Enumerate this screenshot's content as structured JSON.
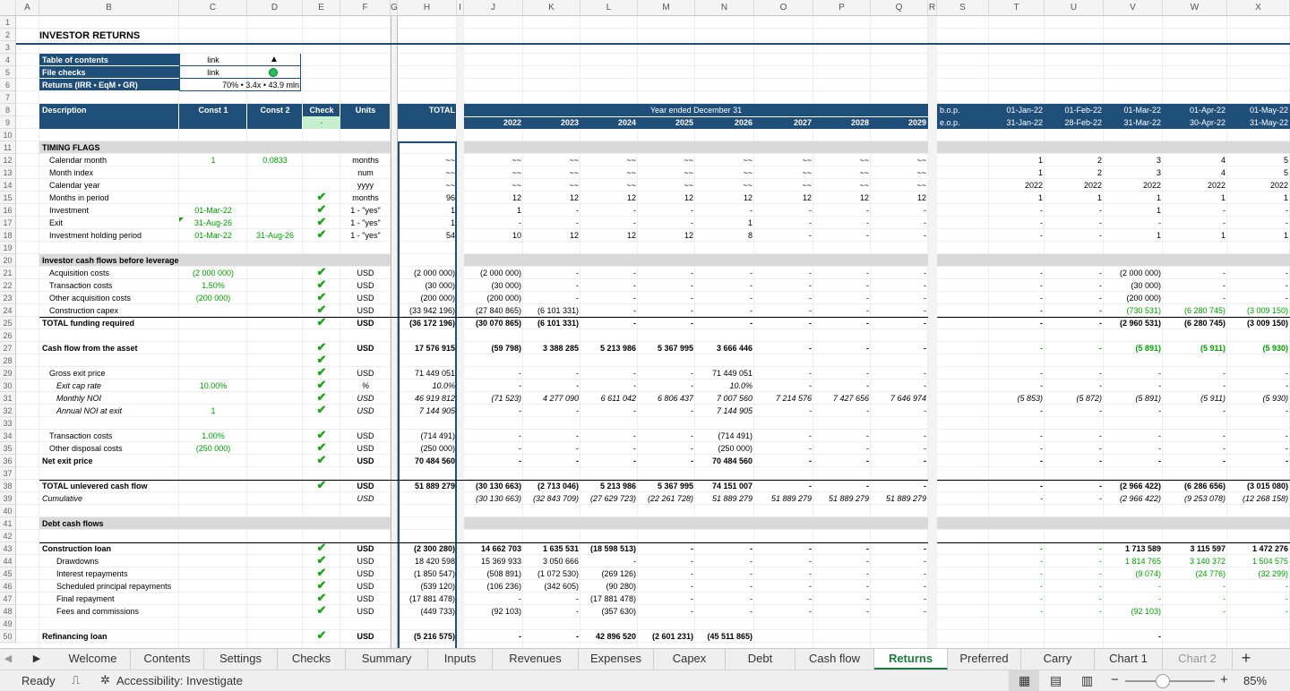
{
  "app": {
    "sheet_name": "Returns",
    "zoom": "85%"
  },
  "columns": [
    "A",
    "B",
    "C",
    "D",
    "E",
    "F",
    "G",
    "H",
    "I",
    "J",
    "K",
    "L",
    "M",
    "N",
    "O",
    "P",
    "Q",
    "R",
    "S",
    "T",
    "U",
    "V",
    "W",
    "X"
  ],
  "rows": [
    "1",
    "2",
    "3",
    "4",
    "5",
    "6",
    "7",
    "8",
    "9",
    "10",
    "11",
    "12",
    "13",
    "14",
    "15",
    "16",
    "17",
    "18",
    "19",
    "20",
    "21",
    "22",
    "23",
    "24",
    "25",
    "26",
    "27",
    "28",
    "29",
    "30",
    "31",
    "32",
    "33",
    "34",
    "35",
    "36",
    "37",
    "38",
    "39",
    "40",
    "41",
    "42",
    "43",
    "44",
    "45",
    "46",
    "47",
    "48",
    "49",
    "50"
  ],
  "title": "INVESTOR RETURNS",
  "toc": {
    "toc_label": "Table of contents",
    "toc_link": "link",
    "toc_icon": "▲",
    "checks_label": "File checks",
    "checks_link": "link",
    "returns_label": "Returns (IRR • EqM • GR)",
    "returns_value": "70% • 3.4x • 43.9 mln"
  },
  "header": {
    "description": "Description",
    "const1": "Const 1",
    "const2": "Const 2",
    "check": "Check",
    "units": "Units",
    "total": "TOTAL",
    "year_ended": "Year ended December 31",
    "check_value": "-",
    "years": [
      "2022",
      "2023",
      "2024",
      "2025",
      "2026",
      "2027",
      "2028",
      "2029"
    ],
    "bop": "b.o.p.",
    "eop": "e.o.p.",
    "month_start": [
      "01-Jan-22",
      "01-Feb-22",
      "01-Mar-22",
      "01-Apr-22",
      "01-May-22"
    ],
    "month_end": [
      "31-Jan-22",
      "28-Feb-22",
      "31-Mar-22",
      "30-Apr-22",
      "31-May-22"
    ]
  },
  "sections": {
    "timing": "TIMING FLAGS",
    "investor": "Investor cash flows before leverage",
    "debt": "Debt cash flows"
  },
  "lines": {
    "r12": {
      "label": "Calendar month",
      "c1": "1",
      "c2": "0.0833",
      "units": "months",
      "total": "~~",
      "y": [
        "~~",
        "~~",
        "~~",
        "~~",
        "~~",
        "~~",
        "~~",
        "~~"
      ],
      "m": [
        "1",
        "2",
        "3",
        "4",
        "5"
      ]
    },
    "r13": {
      "label": "Month index",
      "units": "num",
      "total": "~~",
      "y": [
        "~~",
        "~~",
        "~~",
        "~~",
        "~~",
        "~~",
        "~~",
        "~~"
      ],
      "m": [
        "1",
        "2",
        "3",
        "4",
        "5"
      ]
    },
    "r14": {
      "label": "Calendar year",
      "units": "yyyy",
      "total": "~~",
      "y": [
        "~~",
        "~~",
        "~~",
        "~~",
        "~~",
        "~~",
        "~~",
        "~~"
      ],
      "m": [
        "2022",
        "2022",
        "2022",
        "2022",
        "2022"
      ]
    },
    "r15": {
      "label": "Months in period",
      "units": "months",
      "total": "96",
      "y": [
        "12",
        "12",
        "12",
        "12",
        "12",
        "12",
        "12",
        "12"
      ],
      "m": [
        "1",
        "1",
        "1",
        "1",
        "1"
      ]
    },
    "r16": {
      "label": "Investment",
      "c1": "01-Mar-22",
      "units": "1 - \"yes\"",
      "total": "1",
      "y": [
        "1",
        "-",
        "-",
        "-",
        "-",
        "-",
        "-",
        "-"
      ],
      "m": [
        "-",
        "-",
        "1",
        "-",
        "-"
      ]
    },
    "r17": {
      "label": "Exit",
      "c1": "31-Aug-26",
      "units": "1 - \"yes\"",
      "total": "1",
      "y": [
        "-",
        "-",
        "-",
        "-",
        "1",
        "-",
        "-",
        "-"
      ],
      "m": [
        "-",
        "-",
        "-",
        "-",
        "-"
      ]
    },
    "r18": {
      "label": "Investment holding period",
      "c1": "01-Mar-22",
      "c2": "31-Aug-26",
      "units": "1 - \"yes\"",
      "total": "54",
      "y": [
        "10",
        "12",
        "12",
        "12",
        "8",
        "-",
        "-",
        "-"
      ],
      "m": [
        "-",
        "-",
        "1",
        "1",
        "1"
      ]
    },
    "r21": {
      "label": "Acquisition costs",
      "c1": "(2 000 000)",
      "units": "USD",
      "total": "(2 000 000)",
      "y": [
        "(2 000 000)",
        "-",
        "-",
        "-",
        "-",
        "-",
        "-",
        "-"
      ],
      "m": [
        "-",
        "-",
        "(2 000 000)",
        "-",
        "-"
      ]
    },
    "r22": {
      "label": "Transaction costs",
      "c1": "1.50%",
      "units": "USD",
      "total": "(30 000)",
      "y": [
        "(30 000)",
        "-",
        "-",
        "-",
        "-",
        "-",
        "-",
        "-"
      ],
      "m": [
        "-",
        "-",
        "(30 000)",
        "-",
        "-"
      ]
    },
    "r23": {
      "label": "Other acquisition costs",
      "c1": "(200 000)",
      "units": "USD",
      "total": "(200 000)",
      "y": [
        "(200 000)",
        "-",
        "-",
        "-",
        "-",
        "-",
        "-",
        "-"
      ],
      "m": [
        "-",
        "-",
        "(200 000)",
        "-",
        "-"
      ]
    },
    "r24": {
      "label": "Construction capex",
      "units": "USD",
      "total": "(33 942 196)",
      "y": [
        "(27 840 865)",
        "(6 101 331)",
        "-",
        "-",
        "-",
        "-",
        "-",
        "-"
      ],
      "m": [
        "-",
        "-",
        "(730 531)",
        "(6 280 745)",
        "(3 009 150)"
      ]
    },
    "r25": {
      "label": "TOTAL funding required",
      "units": "USD",
      "total": "(36 172 196)",
      "y": [
        "(30 070 865)",
        "(6 101 331)",
        "-",
        "-",
        "-",
        "-",
        "-",
        "-"
      ],
      "m": [
        "-",
        "-",
        "(2 960 531)",
        "(6 280 745)",
        "(3 009 150)"
      ]
    },
    "r27": {
      "label": "Cash flow from the asset",
      "units": "USD",
      "total": "17 576 915",
      "y": [
        "(59 798)",
        "3 388 285",
        "5 213 986",
        "5 367 995",
        "3 666 446",
        "-",
        "-",
        "-"
      ],
      "m": [
        "-",
        "-",
        "(5 891)",
        "(5 911)",
        "(5 930)"
      ]
    },
    "r29": {
      "label": "Gross exit price",
      "units": "USD",
      "total": "71 449 051",
      "y": [
        "-",
        "-",
        "-",
        "-",
        "71 449 051",
        "-",
        "-",
        "-"
      ],
      "m": [
        "-",
        "-",
        "-",
        "-",
        "-"
      ]
    },
    "r30": {
      "label": "Exit cap rate",
      "c1": "10.00%",
      "units": "%",
      "total": "10.0%",
      "y": [
        "-",
        "-",
        "-",
        "-",
        "10.0%",
        "-",
        "-",
        "-"
      ],
      "m": [
        "-",
        "-",
        "-",
        "-",
        "-"
      ]
    },
    "r31": {
      "label": "Monthly NOI",
      "units": "USD",
      "total": "46 919 812",
      "y": [
        "(71 523)",
        "4 277 090",
        "6 611 042",
        "6 806 437",
        "7 007 560",
        "7 214 576",
        "7 427 656",
        "7 646 974"
      ],
      "m": [
        "(5 853)",
        "(5 872)",
        "(5 891)",
        "(5 911)",
        "(5 930)"
      ]
    },
    "r32": {
      "label": "Annual NOI at exit",
      "c1": "1",
      "units": "USD",
      "total": "7 144 905",
      "y": [
        "-",
        "-",
        "-",
        "-",
        "7 144 905",
        "-",
        "-",
        "-"
      ],
      "m": [
        "-",
        "-",
        "-",
        "-",
        "-"
      ]
    },
    "r34": {
      "label": "Transaction costs",
      "c1": "1.00%",
      "units": "USD",
      "total": "(714 491)",
      "y": [
        "-",
        "-",
        "-",
        "-",
        "(714 491)",
        "-",
        "-",
        "-"
      ],
      "m": [
        "-",
        "-",
        "-",
        "-",
        "-"
      ]
    },
    "r35": {
      "label": "Other disposal costs",
      "c1": "(250 000)",
      "units": "USD",
      "total": "(250 000)",
      "y": [
        "-",
        "-",
        "-",
        "-",
        "(250 000)",
        "-",
        "-",
        "-"
      ],
      "m": [
        "-",
        "-",
        "-",
        "-",
        "-"
      ]
    },
    "r36": {
      "label": "Net exit price",
      "units": "USD",
      "total": "70 484 560",
      "y": [
        "-",
        "-",
        "-",
        "-",
        "70 484 560",
        "-",
        "-",
        "-"
      ],
      "m": [
        "-",
        "-",
        "-",
        "-",
        "-"
      ]
    },
    "r38": {
      "label": "TOTAL unlevered cash flow",
      "units": "USD",
      "total": "51 889 279",
      "y": [
        "(30 130 663)",
        "(2 713 046)",
        "5 213 986",
        "5 367 995",
        "74 151 007",
        "-",
        "-",
        "-"
      ],
      "m": [
        "-",
        "-",
        "(2 966 422)",
        "(6 286 656)",
        "(3 015 080)"
      ]
    },
    "r39": {
      "label": "Cumulative",
      "units": "USD",
      "total": "",
      "y": [
        "(30 130 663)",
        "(32 843 709)",
        "(27 629 723)",
        "(22 261 728)",
        "51 889 279",
        "51 889 279",
        "51 889 279",
        "51 889 279"
      ],
      "m": [
        "-",
        "-",
        "(2 966 422)",
        "(9 253 078)",
        "(12 268 158)"
      ]
    },
    "r43": {
      "label": "Construction loan",
      "units": "USD",
      "total": "(2 300 280)",
      "y": [
        "14 662 703",
        "1 635 531",
        "(18 598 513)",
        "-",
        "-",
        "-",
        "-",
        "-"
      ],
      "m": [
        "-",
        "-",
        "1 713 589",
        "3 115 597",
        "1 472 276"
      ]
    },
    "r44": {
      "label": "Drawdowns",
      "units": "USD",
      "total": "18 420 598",
      "y": [
        "15 369 933",
        "3 050 666",
        "-",
        "-",
        "-",
        "-",
        "-",
        "-"
      ],
      "m": [
        "-",
        "-",
        "1 814 765",
        "3 140 372",
        "1 504 575"
      ]
    },
    "r45": {
      "label": "Interest repayments",
      "units": "USD",
      "total": "(1 850 547)",
      "y": [
        "(508 891)",
        "(1 072 530)",
        "(269 126)",
        "-",
        "-",
        "-",
        "-",
        "-"
      ],
      "m": [
        "-",
        "-",
        "(9 074)",
        "(24 776)",
        "(32 299)"
      ]
    },
    "r46": {
      "label": "Scheduled principal repayments",
      "units": "USD",
      "total": "(539 120)",
      "y": [
        "(106 236)",
        "(342 605)",
        "(90 280)",
        "-",
        "-",
        "-",
        "-",
        "-"
      ],
      "m": [
        "-",
        "-",
        "-",
        "-",
        "-"
      ]
    },
    "r47": {
      "label": "Final repayment",
      "units": "USD",
      "total": "(17 881 478)",
      "y": [
        "-",
        "-",
        "(17 881 478)",
        "-",
        "-",
        "-",
        "-",
        "-"
      ],
      "m": [
        "-",
        "-",
        "-",
        "-",
        "-"
      ]
    },
    "r48": {
      "label": "Fees and commissions",
      "units": "USD",
      "total": "(449 733)",
      "y": [
        "(92 103)",
        "-",
        "(357 630)",
        "-",
        "-",
        "-",
        "-",
        "-"
      ],
      "m": [
        "-",
        "-",
        "(92 103)",
        "-",
        "-"
      ]
    },
    "r50": {
      "label": "Refinancing loan",
      "units": "USD",
      "total": "(5 216 575)",
      "y": [
        "-",
        "-",
        "42 896 520",
        "(2 601 231)",
        "(45 511 865)",
        "",
        "",
        ""
      ],
      "m": [
        "",
        "",
        "-",
        "",
        ""
      ]
    }
  },
  "tabs": [
    "Welcome",
    "Contents",
    "Settings",
    "Checks",
    "Summary",
    "Inputs",
    "Revenues",
    "Expenses",
    "Capex",
    "Debt",
    "Cash flow",
    "Returns",
    "Preferred",
    "Carry",
    "Chart 1",
    "Chart 2"
  ],
  "status": {
    "ready": "Ready",
    "accessibility": "Accessibility: Investigate",
    "zoom": "85%"
  },
  "colors": {
    "header_blue": "#1f4e79",
    "section_grey": "#d9d9d9",
    "input_green": "#00a000",
    "check_green": "#c6efce",
    "active_tab": "#1e7d3e"
  }
}
